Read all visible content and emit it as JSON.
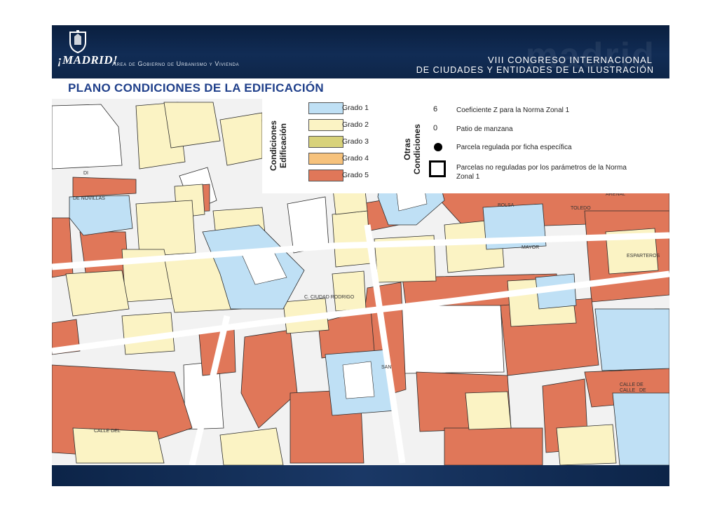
{
  "header": {
    "logo_text": "¡MADRID!",
    "area_text": "Área de Gobierno de Urbanismo y Vivienda",
    "congress_line1": "VIII CONGRESO INTERNACIONAL",
    "congress_line2": "DE CIUDADES Y ENTIDADES DE LA ILUSTRACIÓN",
    "watermark": "madrid"
  },
  "page_title": "PLANO CONDICIONES DE LA EDIFICACIÓN",
  "legend": {
    "edificacion_heading_1": "Condiciones",
    "edificacion_heading_2": "Edificación",
    "grades": [
      {
        "label": "Grado 1",
        "color": "#bfe0f5"
      },
      {
        "label": "Grado 2",
        "color": "#fbf3c4"
      },
      {
        "label": "Grado 3",
        "color": "#d8d27a"
      },
      {
        "label": "Grado 4",
        "color": "#f6c27c"
      },
      {
        "label": "Grado 5",
        "color": "#e07759"
      }
    ],
    "otras_heading_1": "Otras",
    "otras_heading_2": "Condiciones",
    "otras": [
      {
        "symbol": "6",
        "text": "Coeficiente Z para la Norma Zonal 1"
      },
      {
        "symbol": "0",
        "text": "Patio de manzana"
      },
      {
        "symbol": "dot-icon",
        "text": "Parcela regulada por ficha específica"
      },
      {
        "symbol": "square-outline-icon",
        "text": "Parcelas no reguladas por los parámetros de la Norma Zonal 1"
      }
    ]
  },
  "street_labels": [
    "DE NOVILLAS",
    "MAYOR",
    "CALLE",
    "CALLE DE",
    "C. CIUDAD RODRIGO",
    "SAN",
    "CALLE DEL",
    "DE",
    "DI",
    "ESPARTEROS",
    "TOLEDO",
    "BOLSA",
    "ARENAL"
  ],
  "colors": {
    "banner": "#0c2448",
    "title": "#1f3f8a",
    "street": "#f2f2f2",
    "grade1": "#bfe0f5",
    "grade2": "#fbf3c4",
    "grade5": "#e07759",
    "plaza": "#ffffff"
  }
}
